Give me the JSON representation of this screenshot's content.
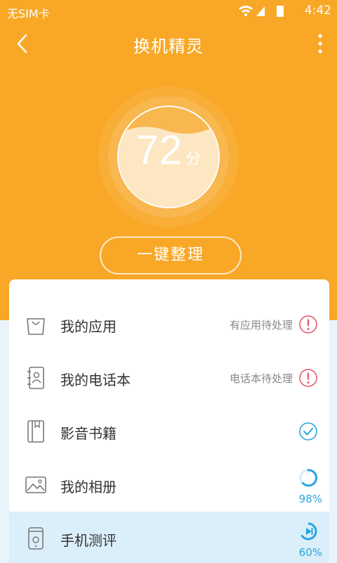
{
  "statusbar": {
    "carrier": "无SIM卡",
    "time": "4:42"
  },
  "appbar": {
    "title": "换机精灵"
  },
  "score": {
    "value": "72",
    "unit": "分"
  },
  "action": {
    "label": "一键整理"
  },
  "items": [
    {
      "label": "我的应用",
      "status": "有应用待处理",
      "state": "warning"
    },
    {
      "label": "我的电话本",
      "status": "电话本待处理",
      "state": "warning"
    },
    {
      "label": "影音书籍",
      "status": "",
      "state": "done"
    },
    {
      "label": "我的相册",
      "progress": "98%",
      "state": "loading"
    },
    {
      "label": "手机测评",
      "progress": "60%",
      "state": "playing"
    }
  ],
  "colors": {
    "primary": "#f8a826",
    "warning": "#e85a6b",
    "accent": "#29a5dc"
  }
}
